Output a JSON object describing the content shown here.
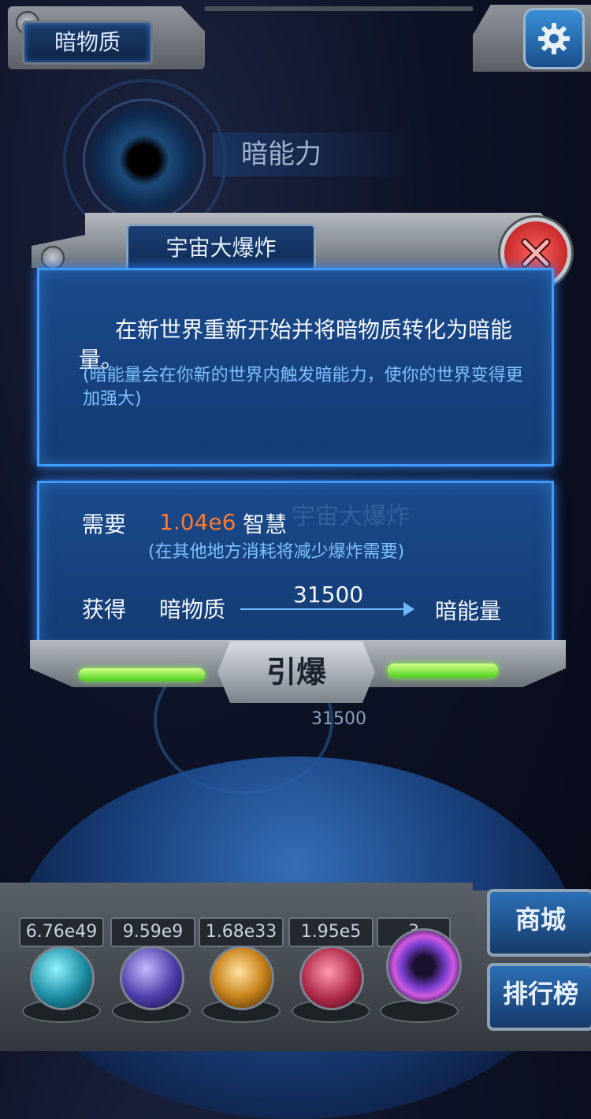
{
  "header": {
    "title": "暗物质",
    "settings_icon": "gear-icon"
  },
  "background": {
    "ability_label": "暗能力",
    "amount": "31500"
  },
  "modal": {
    "title": "宇宙大爆炸",
    "description": "在新世界重新开始并将暗物质转化为暗能量。",
    "note": "(暗能量会在你新的世界内触发暗能力，使你的世界变得更加强大)",
    "ghost_title": "宇宙大爆炸",
    "require_label": "需要",
    "require_value": "1.04e6",
    "require_unit": "智慧",
    "require_note": "(在其他地方消耗将减少爆炸需要)",
    "gain_label": "获得",
    "gain_from": "暗物质",
    "gain_amount": "31500",
    "gain_to": "暗能量",
    "detonate_label": "引爆",
    "close_icon": "close-icon"
  },
  "resources": [
    {
      "value": "6.76e49",
      "icon": "atom-orb-icon",
      "color": "#2fb8c9"
    },
    {
      "value": "9.59e9",
      "icon": "lightning-orb-icon",
      "color": "#6a59c8"
    },
    {
      "value": "1.68e33",
      "icon": "galaxy-orb-icon",
      "color": "#c98a1e"
    },
    {
      "value": "1.95e5",
      "icon": "brain-orb-icon",
      "color": "#c2365a"
    },
    {
      "value": "3",
      "icon": "blackhole-orb-icon",
      "color": "#8a3fc9"
    }
  ],
  "side_buttons": {
    "shop": "商城",
    "leaderboard": "排行榜"
  }
}
